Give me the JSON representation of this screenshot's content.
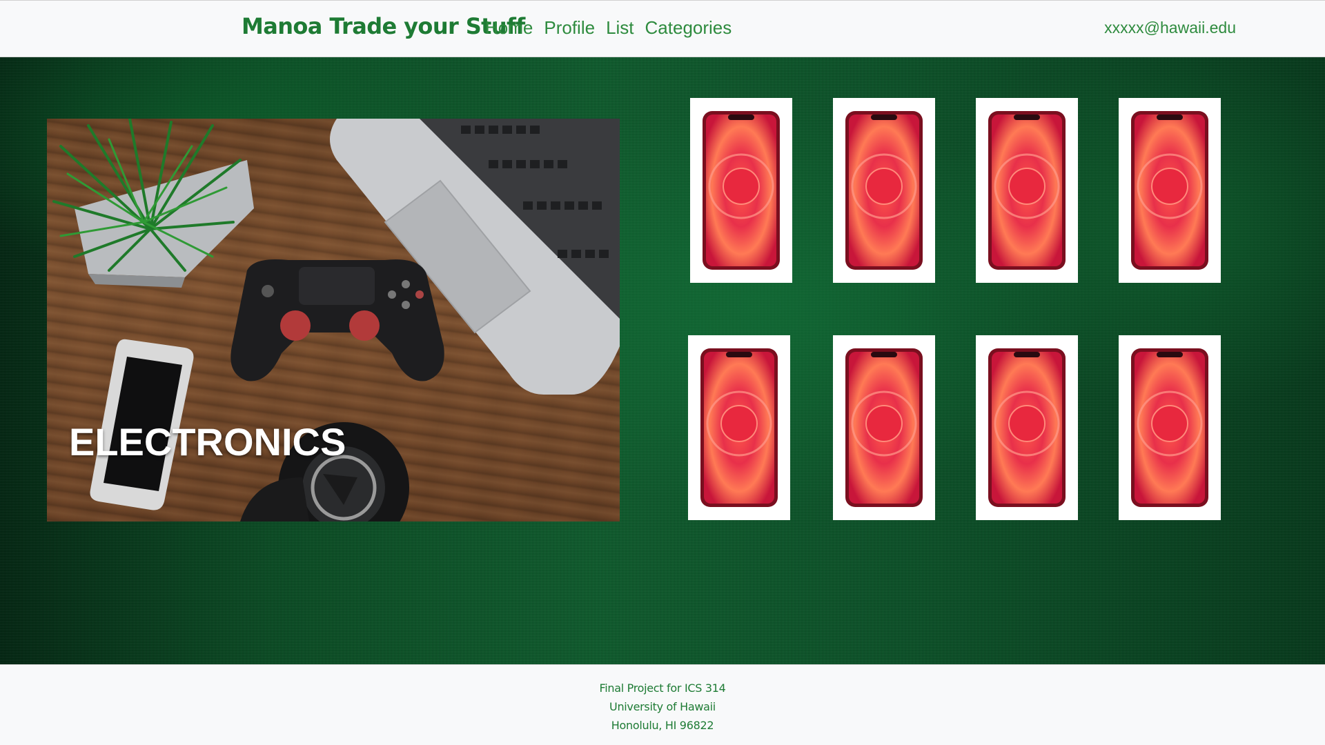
{
  "navbar": {
    "brand": "Manoa Trade your Stuff",
    "links": [
      {
        "label": "Home"
      },
      {
        "label": "Profile"
      },
      {
        "label": "List"
      },
      {
        "label": "Categories"
      }
    ],
    "user_email": "xxxxx@hawaii.edu"
  },
  "main": {
    "category": {
      "title": "ELECTRONICS"
    },
    "products": [
      {
        "icon": "smartphone-icon"
      },
      {
        "icon": "smartphone-icon"
      },
      {
        "icon": "smartphone-icon"
      },
      {
        "icon": "smartphone-icon"
      },
      {
        "icon": "smartphone-icon"
      },
      {
        "icon": "smartphone-icon"
      },
      {
        "icon": "smartphone-icon"
      },
      {
        "icon": "smartphone-icon"
      }
    ]
  },
  "footer": {
    "lines": [
      "Final Project for ICS 314",
      "University of Hawaii",
      "Honolulu, HI 96822"
    ]
  },
  "colors": {
    "brand_green": "#1e7b34",
    "link_green": "#2e8b3e",
    "background_green": "#0e5a2c"
  }
}
